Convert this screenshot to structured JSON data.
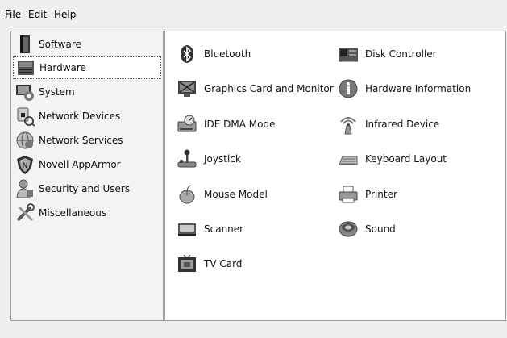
{
  "menu": {
    "file": {
      "mnemonic": "F",
      "rest": "ile"
    },
    "edit": {
      "mnemonic": "E",
      "rest": "dit"
    },
    "help": {
      "mnemonic": "H",
      "rest": "elp"
    }
  },
  "sidebar": {
    "selected": "Hardware",
    "items": [
      {
        "label": "Software",
        "icon": "software-icon"
      },
      {
        "label": "Hardware",
        "icon": "hardware-icon"
      },
      {
        "label": "System",
        "icon": "system-icon"
      },
      {
        "label": "Network Devices",
        "icon": "network-devices-icon"
      },
      {
        "label": "Network Services",
        "icon": "network-services-icon"
      },
      {
        "label": "Novell AppArmor",
        "icon": "apparmor-icon"
      },
      {
        "label": "Security and Users",
        "icon": "security-users-icon"
      },
      {
        "label": "Miscellaneous",
        "icon": "miscellaneous-icon"
      }
    ]
  },
  "modules": [
    {
      "label": "Bluetooth",
      "icon": "bluetooth-icon"
    },
    {
      "label": "Disk Controller",
      "icon": "disk-controller-icon"
    },
    {
      "label": "Graphics Card and Monitor",
      "icon": "monitor-icon"
    },
    {
      "label": "Hardware Information",
      "icon": "info-icon"
    },
    {
      "label": "IDE DMA Mode",
      "icon": "ide-dma-icon"
    },
    {
      "label": "Infrared Device",
      "icon": "infrared-icon"
    },
    {
      "label": "Joystick",
      "icon": "joystick-icon"
    },
    {
      "label": "Keyboard Layout",
      "icon": "keyboard-icon"
    },
    {
      "label": "Mouse Model",
      "icon": "mouse-icon"
    },
    {
      "label": "Printer",
      "icon": "printer-icon"
    },
    {
      "label": "Scanner",
      "icon": "scanner-icon"
    },
    {
      "label": "Sound",
      "icon": "sound-icon"
    },
    {
      "label": "TV Card",
      "icon": "tv-card-icon"
    }
  ]
}
